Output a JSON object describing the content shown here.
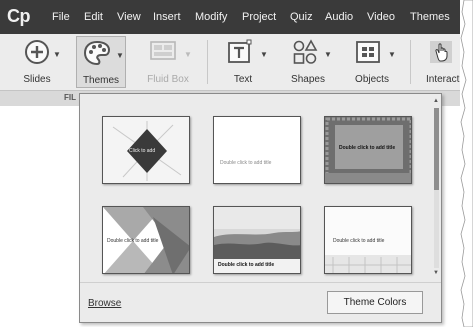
{
  "app": {
    "logo": "Cp"
  },
  "menu": [
    "File",
    "Edit",
    "View",
    "Insert",
    "Modify",
    "Project",
    "Quiz",
    "Audio",
    "Video",
    "Themes"
  ],
  "ribbon": {
    "buttons": [
      {
        "label": "Slides",
        "icon": "plus-circle-icon"
      },
      {
        "label": "Themes",
        "icon": "palette-icon",
        "selected": true
      },
      {
        "label": "Fluid Box",
        "icon": "fluid-box-icon",
        "disabled": true
      },
      {
        "label": "Text",
        "icon": "text-box-icon"
      },
      {
        "label": "Shapes",
        "icon": "shapes-icon"
      },
      {
        "label": "Objects",
        "icon": "objects-grid-icon"
      },
      {
        "label": "Interacti",
        "icon": "hand-pointer-icon"
      }
    ],
    "group_caption": "FIL"
  },
  "themes_panel": {
    "thumbnails": [
      {
        "caption": "Click to add"
      },
      {
        "caption": "Double click to add title"
      },
      {
        "caption": "Double click to add title"
      },
      {
        "caption": "Double click to add title"
      },
      {
        "caption": "Double click to add title"
      },
      {
        "caption": "Double click to add title"
      }
    ],
    "browse_label": "Browse",
    "theme_colors_label": "Theme Colors"
  }
}
